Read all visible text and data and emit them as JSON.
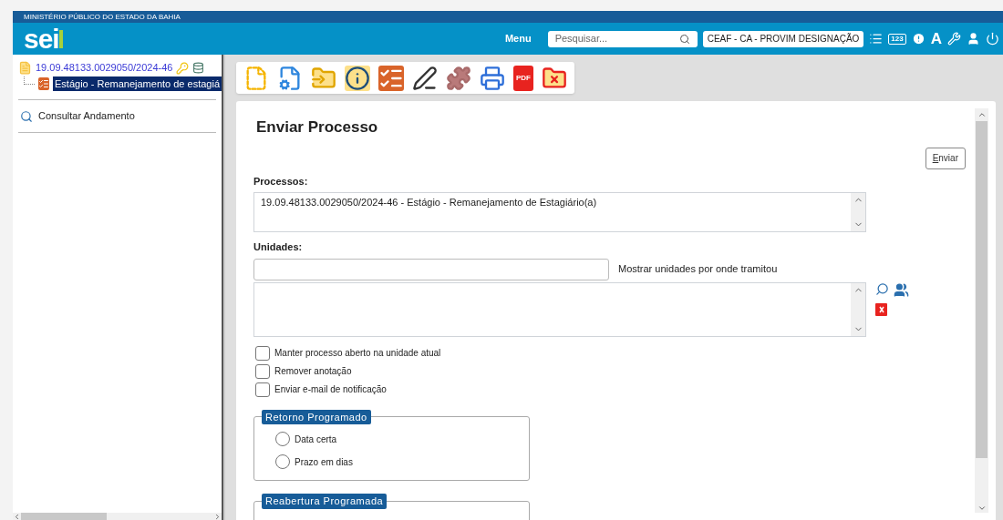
{
  "header": {
    "org": "MINISTÉRIO PÚBLICO DO ESTADO DA BAHIA",
    "logo": "sei",
    "menu": "Menu",
    "search": {
      "placeholder": "Pesquisar..."
    },
    "unit": "CEAF - CA - PROVIM DESIGNAÇÃO",
    "counter_icon": "123",
    "font_icon": "A"
  },
  "tree": [
    {
      "label": "19.09.48133.0029050/2024-46",
      "selected": false,
      "children": [
        {
          "label": "Estágio - Remanejamento de estagiá",
          "selected": true
        }
      ]
    }
  ],
  "sidebar": {
    "items": [
      {
        "label": "Consultar Andamento"
      }
    ]
  },
  "toolbar": {
    "pdf_label": "PDF"
  },
  "form": {
    "title": "Enviar Processo",
    "submit": "Enviar",
    "processos": {
      "label": "Processos:",
      "items": [
        "19.09.48133.0029050/2024-46 - Estágio - Remanejamento de Estagiário(a)"
      ]
    },
    "unidades": {
      "label": "Unidades:",
      "link": "Mostrar unidades por onde tramitou"
    },
    "options": [
      {
        "label": "Manter processo aberto na unidade atual",
        "checked": false
      },
      {
        "label": "Remover anotação",
        "checked": false
      },
      {
        "label": "Enviar e-mail de notificação",
        "checked": false
      }
    ],
    "groups": [
      {
        "legend": "Retorno Programado",
        "options": [
          {
            "label": "Data certa",
            "selected": false
          },
          {
            "label": "Prazo em dias",
            "selected": false
          }
        ]
      },
      {
        "legend": "Reabertura Programada"
      }
    ]
  }
}
